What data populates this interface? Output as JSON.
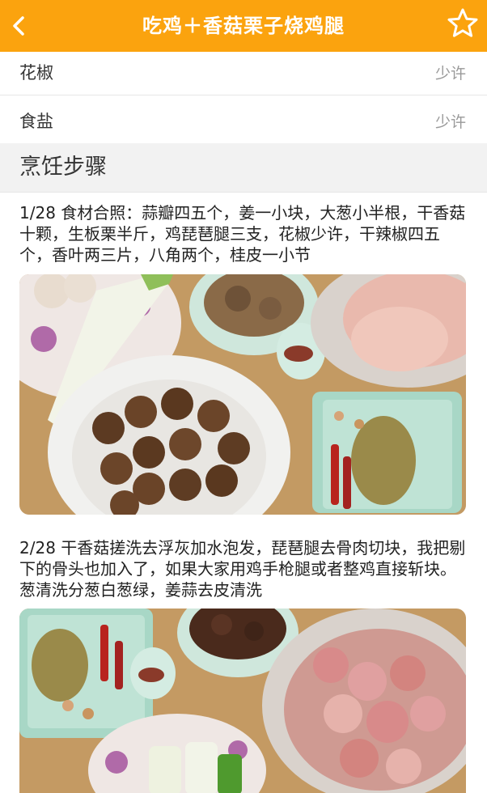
{
  "header": {
    "title": "吃鸡＋香菇栗子烧鸡腿",
    "back_icon": "chevron-left-icon",
    "favorite_icon": "star-outline-icon",
    "accent_color": "#fba30e"
  },
  "ingredients": [
    {
      "name": "花椒",
      "amount": "少许"
    },
    {
      "name": "食盐",
      "amount": "少许"
    }
  ],
  "steps_section": {
    "title": "烹饪步骤"
  },
  "steps": [
    {
      "text": "1/28 食材合照：蒜瓣四五个，姜一小块，大葱小半根，干香菇十颗，生板栗半斤，鸡琵琶腿三支，花椒少许，干辣椒四五个，香叶两三片，八角两个，桂皮一小节"
    },
    {
      "text": "2/28 干香菇搓洗去浮灰加水泡发，琵琶腿去骨肉切块，我把剔下的骨头也加入了，如果大家用鸡手枪腿或者整鸡直接斩块。葱清洗分葱白葱绿，姜蒜去皮清洗"
    }
  ]
}
